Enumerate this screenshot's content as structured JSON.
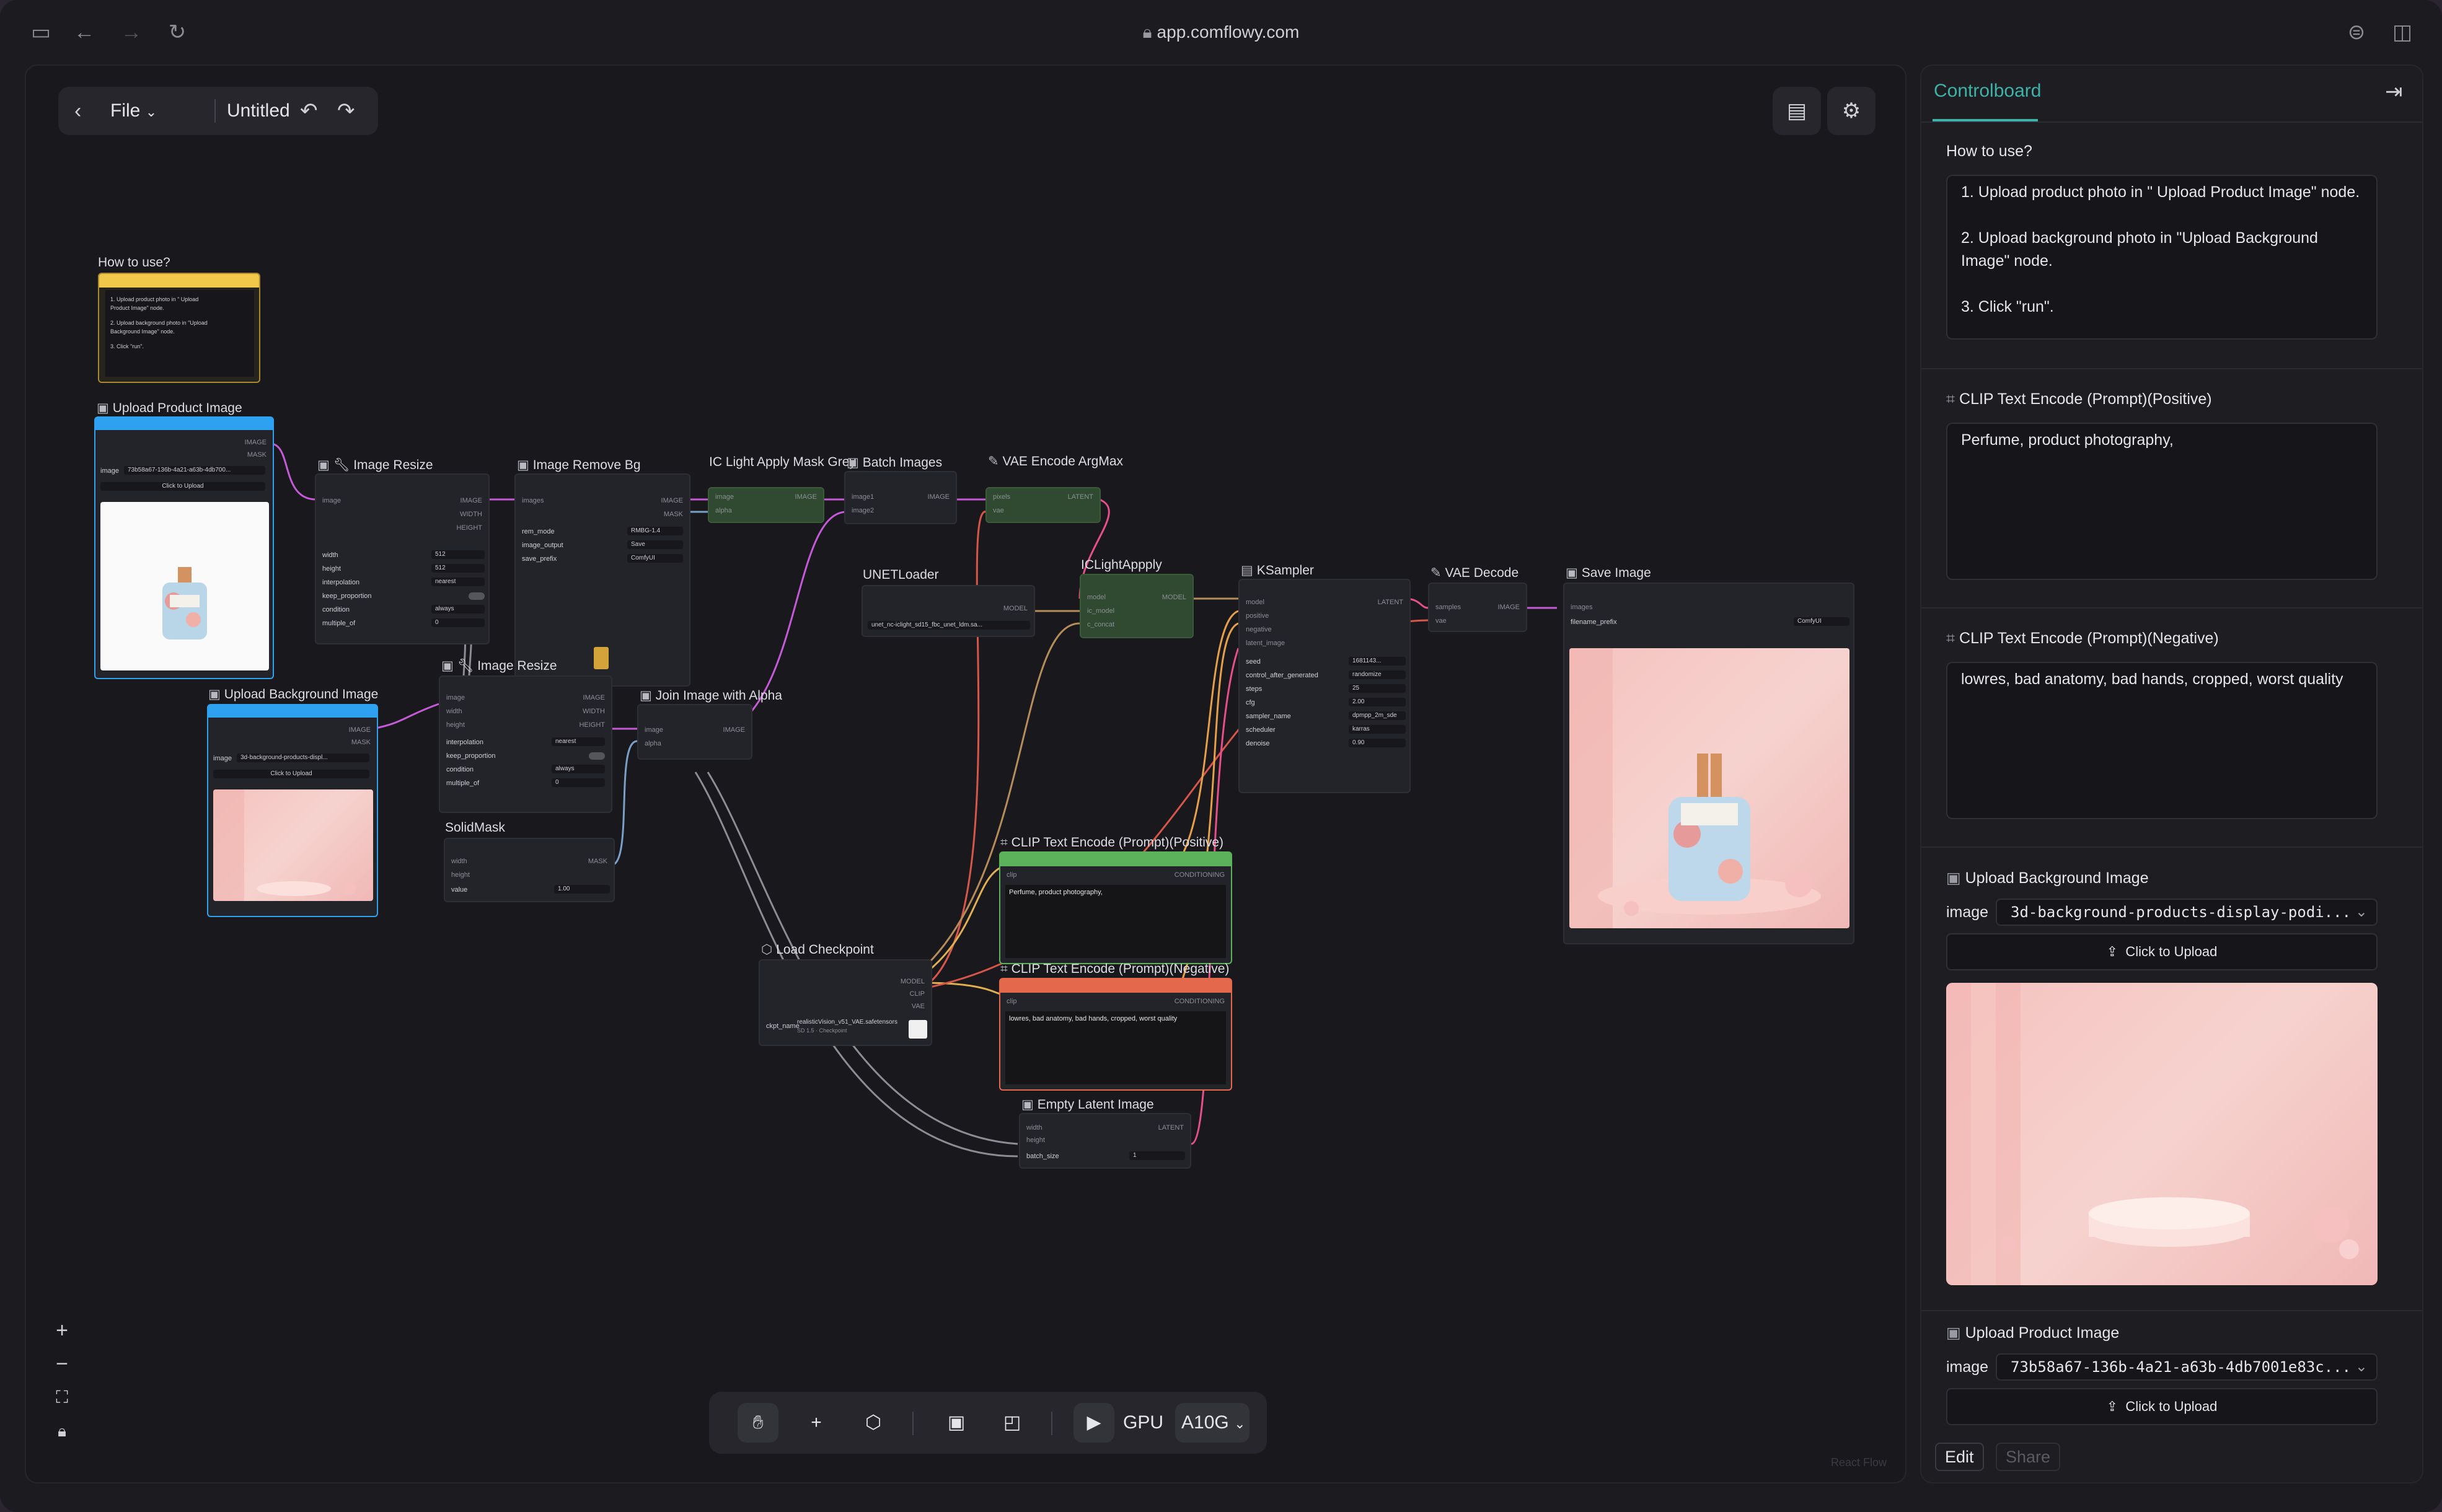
{
  "browser": {
    "url": "app.comflowy.com"
  },
  "toolbar": {
    "file_label": "File",
    "doc_title": "Untitled"
  },
  "how_to_use_node": {
    "title": "How to use?",
    "lines": [
      "1. Upload product photo in \" Upload",
      "Product Image\" node.",
      "2. Upload background photo in \"Upload",
      "Background Image\" node.",
      "3. Click \"run\"."
    ]
  },
  "nodes": {
    "upload_product": {
      "title": "Upload Product Image",
      "out1": "IMAGE",
      "out2": "MASK",
      "widget_label": "image",
      "widget_value": "73b58a67-136b-4a21-a63b-4db700...",
      "upload_label": "Click to Upload"
    },
    "upload_bg": {
      "title": "Upload Background Image",
      "out1": "IMAGE",
      "out2": "MASK",
      "widget_label": "image",
      "widget_value": "3d-background-products-displ...",
      "upload_label": "Click to Upload"
    },
    "resize1": {
      "title": "Image Resize",
      "in1": "image",
      "out1": "IMAGE",
      "out2": "WIDTH",
      "out3": "HEIGHT",
      "rows": [
        [
          "width",
          "512"
        ],
        [
          "height",
          "512"
        ],
        [
          "interpolation",
          "nearest"
        ],
        [
          "keep_proportion",
          ""
        ],
        [
          "condition",
          "always"
        ],
        [
          "multiple_of",
          "0"
        ]
      ]
    },
    "remove_bg": {
      "title": "Image Remove Bg",
      "in1": "images",
      "out1": "IMAGE",
      "out2": "MASK",
      "rows": [
        [
          "rem_mode",
          "RMBG-1.4"
        ],
        [
          "image_output",
          "Save"
        ],
        [
          "save_prefix",
          "ComfyUI"
        ]
      ]
    },
    "ic_light_mask": {
      "title": "IC Light Apply Mask Grey",
      "in1": "image",
      "in2": "alpha",
      "out1": "IMAGE"
    },
    "batch_images": {
      "title": "Batch Images",
      "in1": "image1",
      "in2": "image2",
      "out1": "IMAGE"
    },
    "vae_encode": {
      "title": "VAE Encode ArgMax",
      "in1": "pixels",
      "in2": "vae",
      "out1": "LATENT"
    },
    "unet_loader": {
      "title": "UNETLoader",
      "out1": "MODEL",
      "value": "unet_nc-iclight_sd15_fbc_unet_ldm.sa..."
    },
    "iclight_apply": {
      "title": "ICLightAppply",
      "in1": "model",
      "in2": "ic_model",
      "in3": "c_concat",
      "out1": "MODEL"
    },
    "ksampler": {
      "title": "KSampler",
      "in1": "model",
      "in2": "positive",
      "in3": "negative",
      "in4": "latent_image",
      "out1": "LATENT",
      "rows": [
        [
          "seed",
          "1681143..."
        ],
        [
          "control_after_generated",
          "randomize"
        ],
        [
          "steps",
          "25"
        ],
        [
          "cfg",
          "2.00"
        ],
        [
          "sampler_name",
          "dpmpp_2m_sde"
        ],
        [
          "scheduler",
          "karras"
        ],
        [
          "denoise",
          "0.90"
        ]
      ]
    },
    "vae_decode": {
      "title": "VAE Decode",
      "in1": "samples",
      "in2": "vae",
      "out1": "IMAGE"
    },
    "save_image": {
      "title": "Save Image",
      "in1": "images",
      "row_label": "filename_prefix",
      "row_value": "ComfyUI"
    },
    "resize2": {
      "title": "Image Resize",
      "in1": "image",
      "in2": "width",
      "in3": "height",
      "out1": "IMAGE",
      "out2": "WIDTH",
      "out3": "HEIGHT",
      "rows": [
        [
          "interpolation",
          "nearest"
        ],
        [
          "keep_proportion",
          ""
        ],
        [
          "condition",
          "always"
        ],
        [
          "multiple_of",
          "0"
        ]
      ]
    },
    "join_alpha": {
      "title": "Join Image with Alpha",
      "in1": "image",
      "in2": "alpha",
      "out1": "IMAGE"
    },
    "solid_mask": {
      "title": "SolidMask",
      "in1": "width",
      "in2": "height",
      "out1": "MASK",
      "row_label": "value",
      "row_value": "1.00"
    },
    "load_checkpoint": {
      "title": "Load Checkpoint",
      "out1": "MODEL",
      "out2": "CLIP",
      "out3": "VAE",
      "row_label": "ckpt_name",
      "row_value": "realisticVision_v51_VAE.safetensors",
      "row_sub": "SD 1.5 · Checkpoint"
    },
    "clip_pos": {
      "title": "CLIP Text Encode (Prompt)(Positive)",
      "in1": "clip",
      "out1": "CONDITIONING",
      "text": "Perfume, product photography,"
    },
    "clip_neg": {
      "title": "CLIP Text Encode (Prompt)(Negative)",
      "in1": "clip",
      "out1": "CONDITIONING",
      "text": "lowres, bad anatomy, bad hands, cropped, worst quality"
    },
    "empty_latent": {
      "title": "Empty Latent Image",
      "in1": "width",
      "in2": "height",
      "out1": "LATENT",
      "row_label": "batch_size",
      "row_value": "1"
    }
  },
  "dock": {
    "gpu_label": "GPU",
    "gpu_value": "A10G"
  },
  "watermark": "React Flow",
  "controlboard": {
    "tab": "Controlboard",
    "how_label": "How to use?",
    "how_text": "1. Upload product photo in \" Upload Product Image\" node.\n\n2. Upload background photo in \"Upload Background Image\" node.\n\n3. Click \"run\".",
    "pos_label": "CLIP Text Encode (Prompt)(Positive)",
    "pos_text": "Perfume, product photography,",
    "neg_label": "CLIP Text Encode (Prompt)(Negative)",
    "neg_text": "lowres, bad anatomy, bad hands, cropped, worst quality",
    "bg_label": "Upload Background Image",
    "bg_image_label": "image",
    "bg_image_value": "3d-background-products-display-podi...",
    "bg_upload": "Click to Upload",
    "prod_label": "Upload Product Image",
    "prod_image_label": "image",
    "prod_image_value": "73b58a67-136b-4a21-a63b-4db7001e83c...",
    "prod_upload": "Click to Upload",
    "edit_label": "Edit",
    "share_label": "Share"
  },
  "colors": {
    "accent": "#3fb2a8",
    "image_edge": "#c35ad6",
    "model_edge": "#b58c5a",
    "clip_edge": "#e0b050",
    "latent_edge": "#e6508a",
    "vae_edge": "#d6564a",
    "selected_node": "#2ea2f0",
    "note_yellow": "#f2c84b",
    "positive_green": "#5cb25a",
    "negative_red": "#e4694c"
  }
}
